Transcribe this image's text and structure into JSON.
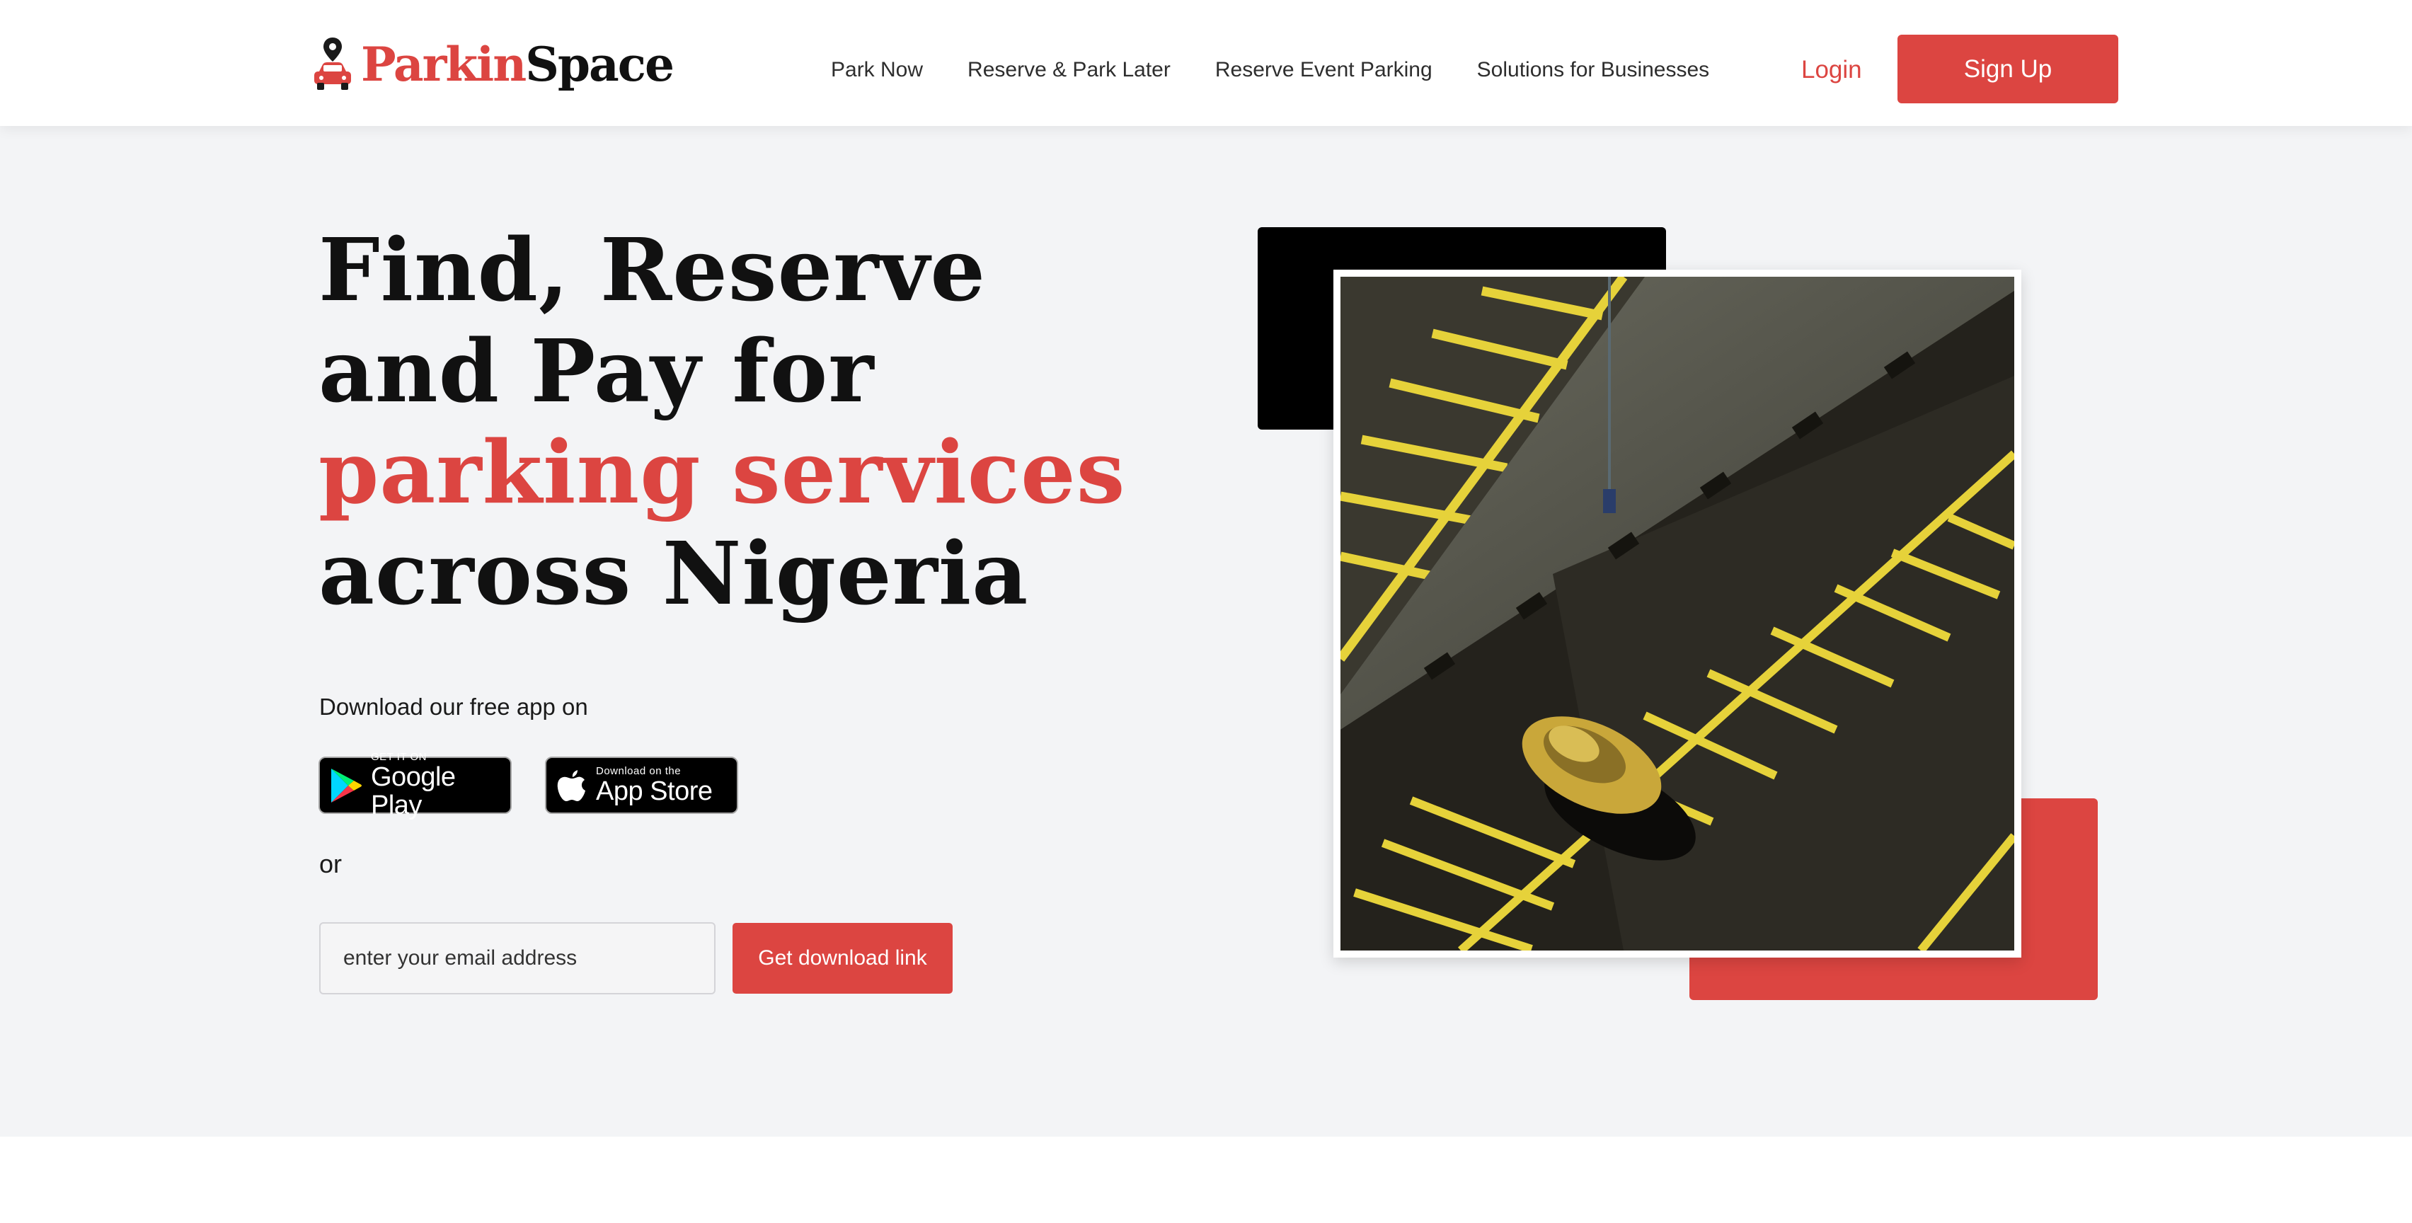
{
  "brand": {
    "name_part1": "Parkin",
    "name_part2": "Space",
    "accent_color": "#dc4541",
    "dark_color": "#111111"
  },
  "nav": {
    "links": [
      "Park Now",
      "Reserve & Park Later",
      "Reserve Event Parking",
      "Solutions for Businesses"
    ],
    "login_label": "Login",
    "signup_label": "Sign Up"
  },
  "hero": {
    "headline_lines": [
      "Find, Reserve",
      "and Pay for",
      "parking services",
      "across Nigeria"
    ],
    "download_text": "Download our free app on",
    "google_play": {
      "small": "GET IT ON",
      "big": "Google Play",
      "icon": "google-play-icon"
    },
    "app_store": {
      "small": "Download on the",
      "big": "App Store",
      "icon": "apple-icon"
    },
    "or_text": "or",
    "email_placeholder": "enter your email address",
    "download_button_label": "Get download link",
    "image": {
      "description_icon": "parking-lot-photo",
      "marking_color": "#e6d23a"
    }
  }
}
